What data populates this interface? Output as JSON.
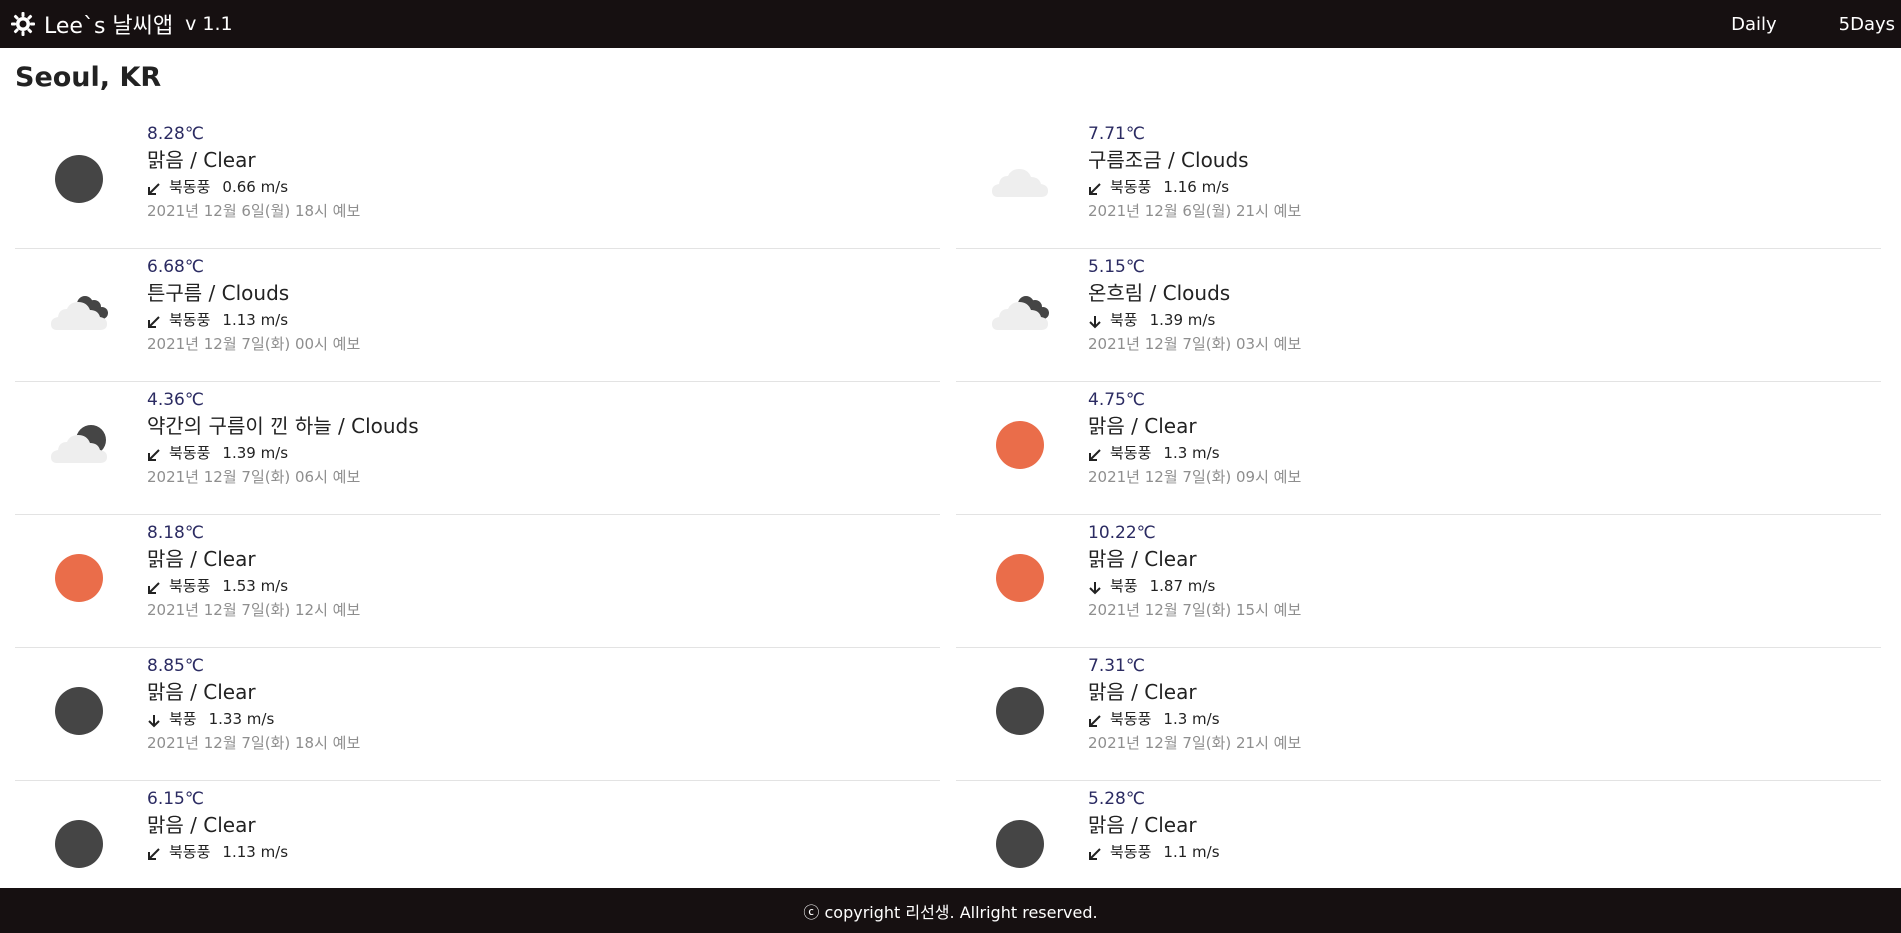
{
  "app": {
    "title": "Lee`s 날씨앱",
    "version": "v 1.1",
    "logo_icon": "sun-gear-icon"
  },
  "nav": {
    "daily": "Daily",
    "fivedays": "5Days"
  },
  "city": "Seoul, KR",
  "colors": {
    "topbar": "#161011",
    "sun": "#ea6d4a",
    "moon": "#454545",
    "cloud": "#eeeeee",
    "temp": "#2b2b62"
  },
  "forecasts": [
    {
      "temp": "8.28℃",
      "desc": "맑음 / Clear",
      "wind_dir": "북동풍",
      "wind_speed": "0.66 m/s",
      "wind_icon": "arrow-southwest-icon",
      "date": "2021년 12월 6일(월) 18시 예보",
      "icon": "moon-icon"
    },
    {
      "temp": "7.71℃",
      "desc": "구름조금 / Clouds",
      "wind_dir": "북동풍",
      "wind_speed": "1.16 m/s",
      "wind_icon": "arrow-southwest-icon",
      "date": "2021년 12월 6일(월) 21시 예보",
      "icon": "cloud-icon"
    },
    {
      "temp": "6.68℃",
      "desc": "튼구름 / Clouds",
      "wind_dir": "북동풍",
      "wind_speed": "1.13 m/s",
      "wind_icon": "arrow-southwest-icon",
      "date": "2021년 12월 7일(화) 00시 예보",
      "icon": "broken-clouds-icon"
    },
    {
      "temp": "5.15℃",
      "desc": "온흐림 / Clouds",
      "wind_dir": "북풍",
      "wind_speed": "1.39 m/s",
      "wind_icon": "arrow-south-icon",
      "date": "2021년 12월 7일(화) 03시 예보",
      "icon": "broken-clouds-icon"
    },
    {
      "temp": "4.36℃",
      "desc": "약간의 구름이 낀 하늘 / Clouds",
      "wind_dir": "북동풍",
      "wind_speed": "1.39 m/s",
      "wind_icon": "arrow-southwest-icon",
      "date": "2021년 12월 7일(화) 06시 예보",
      "icon": "moon-cloud-icon"
    },
    {
      "temp": "4.75℃",
      "desc": "맑음 / Clear",
      "wind_dir": "북동풍",
      "wind_speed": "1.3 m/s",
      "wind_icon": "arrow-southwest-icon",
      "date": "2021년 12월 7일(화) 09시 예보",
      "icon": "sun-icon"
    },
    {
      "temp": "8.18℃",
      "desc": "맑음 / Clear",
      "wind_dir": "북동풍",
      "wind_speed": "1.53 m/s",
      "wind_icon": "arrow-southwest-icon",
      "date": "2021년 12월 7일(화) 12시 예보",
      "icon": "sun-icon"
    },
    {
      "temp": "10.22℃",
      "desc": "맑음 / Clear",
      "wind_dir": "북풍",
      "wind_speed": "1.87 m/s",
      "wind_icon": "arrow-south-icon",
      "date": "2021년 12월 7일(화) 15시 예보",
      "icon": "sun-icon"
    },
    {
      "temp": "8.85℃",
      "desc": "맑음 / Clear",
      "wind_dir": "북풍",
      "wind_speed": "1.33 m/s",
      "wind_icon": "arrow-south-icon",
      "date": "2021년 12월 7일(화) 18시 예보",
      "icon": "moon-icon"
    },
    {
      "temp": "7.31℃",
      "desc": "맑음 / Clear",
      "wind_dir": "북동풍",
      "wind_speed": "1.3 m/s",
      "wind_icon": "arrow-southwest-icon",
      "date": "2021년 12월 7일(화) 21시 예보",
      "icon": "moon-icon"
    },
    {
      "temp": "6.15℃",
      "desc": "맑음 / Clear",
      "wind_dir": "북동풍",
      "wind_speed": "1.13 m/s",
      "wind_icon": "arrow-southwest-icon",
      "date": "",
      "icon": "moon-icon"
    },
    {
      "temp": "5.28℃",
      "desc": "맑음 / Clear",
      "wind_dir": "북동풍",
      "wind_speed": "1.1 m/s",
      "wind_icon": "arrow-southwest-icon",
      "date": "",
      "icon": "moon-icon"
    }
  ],
  "footer": {
    "text": "ⓒ copyright 리선생. Allright reserved."
  }
}
